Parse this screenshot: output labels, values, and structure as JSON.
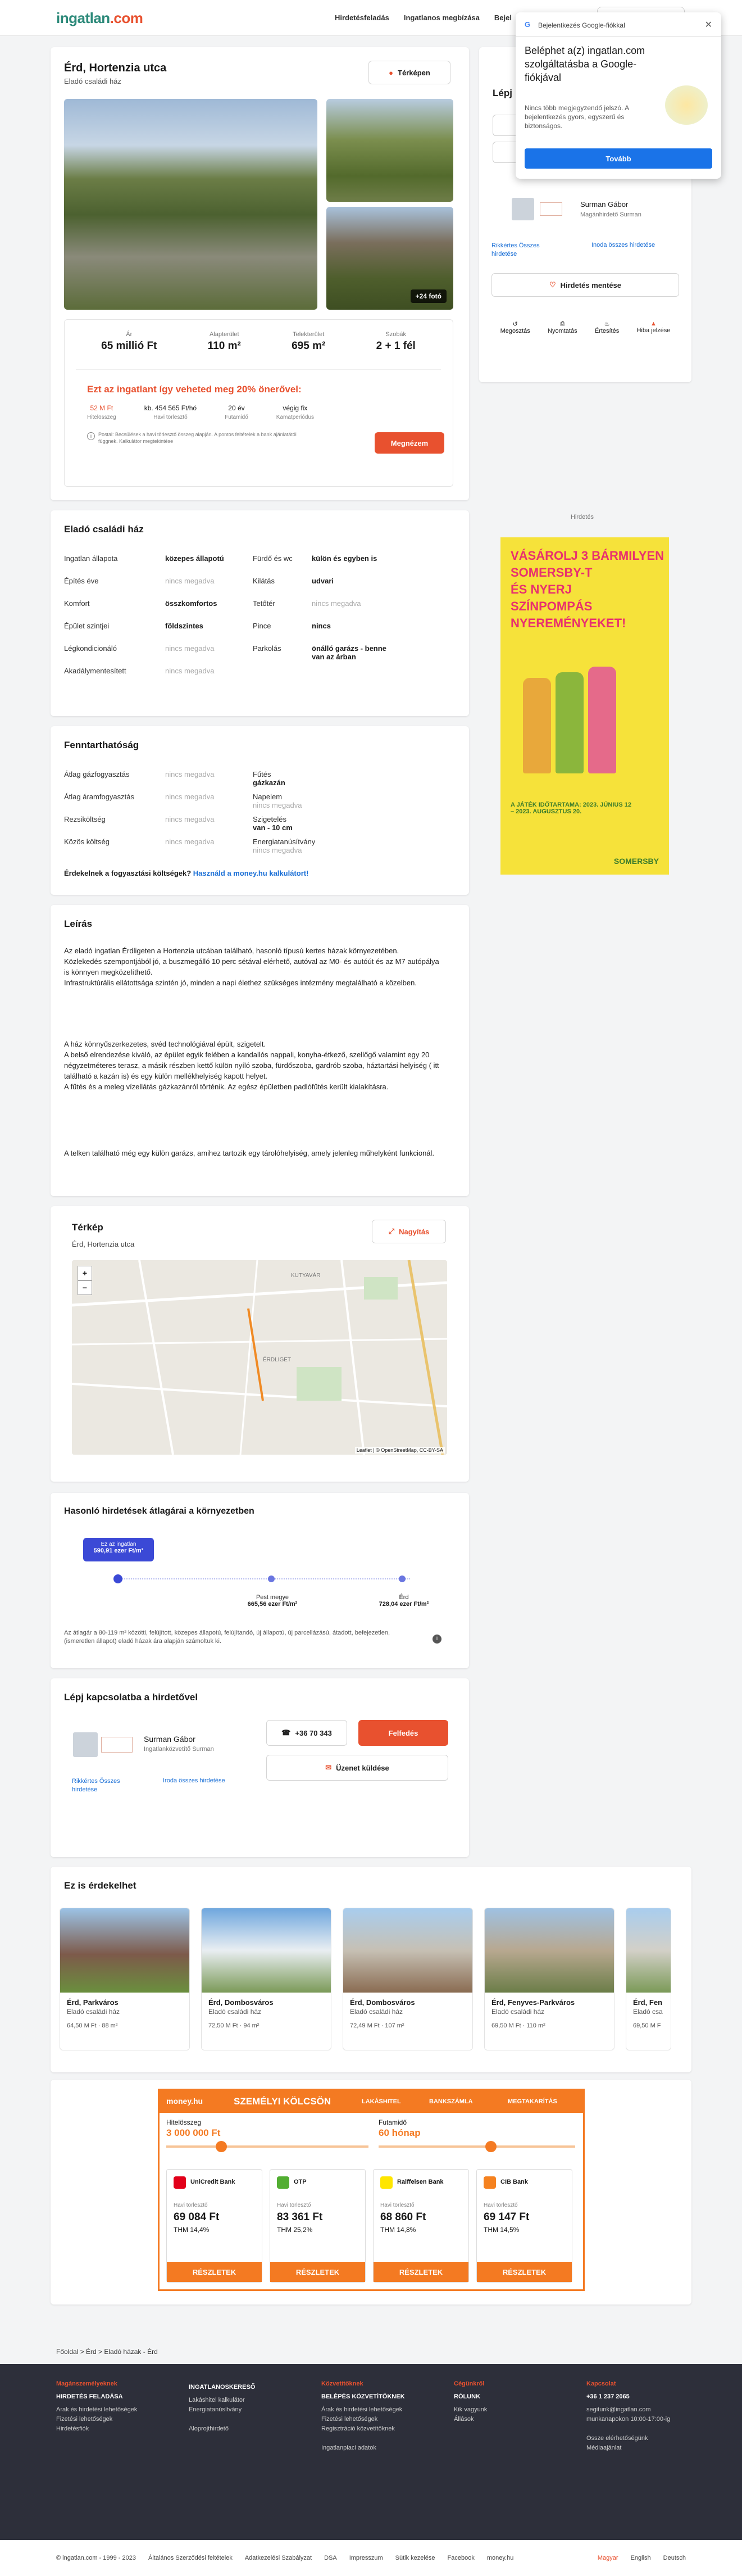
{
  "header": {
    "logo_main": "ingatlan",
    "logo_dot": ".com",
    "nav": [
      "Hirdetésfeladás",
      "Ingatlanos megbízása",
      "Bejel"
    ]
  },
  "popup": {
    "title": "Bejelentkezés Google-fiókkal",
    "heading": "Beléphet a(z) ingatlan.com szolgáltatásba a Google-fiókjával",
    "text": "Nincs több megjegyzendő jelszó. A bejelentkezés gyors, egyszerű és biztonságos.",
    "button": "Tovább"
  },
  "listing": {
    "title": "Érd, Hortenzia utca",
    "subtitle": "Eladó családi ház",
    "map_button": "Térképen",
    "photo_badge": "+24 fotó",
    "stats": [
      {
        "label": "Ár",
        "value": "65 millió Ft"
      },
      {
        "label": "Alapterület",
        "value": "110 m²"
      },
      {
        "label": "Telekterület",
        "value": "695 m²"
      },
      {
        "label": "Szobák",
        "value": "2 + 1 fél"
      }
    ],
    "loan_heading": "Ezt az ingatlant így veheted meg 20% önerővel:",
    "loan_values": [
      {
        "value": "52 M Ft",
        "label": "Hitelösszeg"
      },
      {
        "value": "kb. 454 565 Ft/hó",
        "label": "Havi törlesztő"
      },
      {
        "value": "20 év",
        "label": "Futamidő"
      },
      {
        "value": "végig fix",
        "label": "Kamatperiódus"
      }
    ],
    "loan_note": "Postai: Becsülések a havi törlesztő összeg alapján. A pontos feltételek a bank ajánlatától függnek. Kalkulátor megtekintése",
    "loan_button": "Megnézem"
  },
  "contact_side": {
    "title": "Lépj",
    "agent": "Surman Gábor",
    "agent_role": "Magánhirdető Surman",
    "link1": "Rikkértes Összes",
    "link1b": "hirdetése",
    "link2": "Inoda összes hirdetése",
    "save": "Hirdetés mentése",
    "actions": [
      "Megosztás",
      "Nyomtatás",
      "Értesítés",
      "Hiba jelzése"
    ]
  },
  "ad_label": "Hirdetés",
  "ad1": {
    "line1": "VÁSÁROLJ 3 BÁRMILYEN",
    "line2": "SOMERSBY-T",
    "line3": "ÉS NYERJ",
    "line4": "SZÍNPOMPÁS",
    "line5": "NYEREMÉNYEKET!",
    "brand": "SOMERSBY",
    "promo": "A JÁTÉK IDŐTARTAMA: 2023. JÚNIUS 12 – 2023. AUGUSZTUS 20."
  },
  "details": {
    "title": "Eladó családi ház",
    "left": [
      {
        "k": "Ingatlan állapota",
        "v": "közepes állapotú",
        "m": false
      },
      {
        "k": "Építés éve",
        "v": "nincs megadva",
        "m": true
      },
      {
        "k": "Komfort",
        "v": "összkomfortos",
        "m": false
      },
      {
        "k": "Épület szintjei",
        "v": "földszintes",
        "m": false
      },
      {
        "k": "Légkondicionáló",
        "v": "nincs megadva",
        "m": true
      },
      {
        "k": "Akadálymentesített",
        "v": "nincs megadva",
        "m": true
      }
    ],
    "right": [
      {
        "k": "Fürdő és wc",
        "v": "külön és egyben is",
        "m": false
      },
      {
        "k": "Kilátás",
        "v": "udvari",
        "m": false
      },
      {
        "k": "Tetőtér",
        "v": "nincs megadva",
        "m": true
      },
      {
        "k": "Pince",
        "v": "nincs",
        "m": false
      },
      {
        "k": "Parkolás",
        "v": "önálló garázs - benne van az árban",
        "m": false
      }
    ]
  },
  "sustain": {
    "title": "Fenntarthatóság",
    "left": [
      {
        "k": "Átlag gázfogyasztás",
        "v": "nincs megadva"
      },
      {
        "k": "Átlag áramfogyasztás",
        "v": "nincs megadva"
      },
      {
        "k": "Rezsiköltség",
        "v": "nincs megadva"
      },
      {
        "k": "Közös költség",
        "v": "nincs megadva"
      }
    ],
    "right": [
      {
        "k": "Fűtés",
        "v": "gázkazán",
        "m": false
      },
      {
        "k": "Napelem",
        "v": "nincs megadva",
        "m": true
      },
      {
        "k": "Szigetelés",
        "v": "van - 10 cm",
        "m": false
      },
      {
        "k": "Energiatanúsítvány",
        "v": "nincs megadva",
        "m": true
      }
    ],
    "question": "Érdekelnek a fogyasztási költségek?",
    "link": "Használd a money.hu kalkulátort!"
  },
  "desc": {
    "title": "Leírás",
    "p1": [
      "Az eladó ingatlan Érdligeten a Hortenzia utcában található, hasonló típusú kertes házak környezetében.",
      "Közlekedés szempontjából jó, a buszmegálló 10 perc sétával elérhető, autóval az M0- és autóút és az M7 autópálya is könnyen megközelíthető.",
      "Infrastruktúrális ellátottsága szintén jó, minden a napi élethez szükséges intézmény megtalálható a közelben."
    ],
    "p2": [
      "A ház könnyűszerkezetes, svéd technológiával épült, szigetelt.",
      "A belső elrendezése kiváló, az épület egyik felében a kandallós nappali, konyha-étkező, szellőgő valamint egy 20 négyzetméteres terasz, a másik részben kettő külön nyíló szoba, fürdőszoba, gardrób szoba, háztartási helyiség ( itt található a kazán is) és egy külön mellékhelyiség kapott helyet.",
      "A fűtés és a meleg vízellátás gázkazánról történik. Az egész épületben padlófűtés került kialakításra."
    ],
    "p3": [
      "A telken található még egy külön garázs, amihez tartozik egy tárolóhelyiség, amely jelenleg műhelyként funkcionál."
    ]
  },
  "map": {
    "title": "Térkép",
    "subtitle": "Érd, Hortenzia utca",
    "button": "Nagyítás",
    "zoom_in": "+",
    "zoom_out": "−",
    "labels": [
      "KUTYAVÁR",
      "ÉRDLIGET"
    ],
    "attrib": "Leaflet | © OpenStreetMap, CC-BY-SA"
  },
  "price_cmp": {
    "title": "Hasonló hirdetések átlagárai a környezetben",
    "bubble1": "Ez az ingatlan",
    "bubble2": "590,91 ezer Ft/m²",
    "p1": "Pest megye",
    "p1v": "665,56 ezer Ft/m²",
    "p2": "Érd",
    "p2v": "728,04 ezer Ft/m²",
    "note": "Az átlagár a 80-119 m² közötti, felújított, közepes állapotú, felújítandó, új állapotú, új parcellázású, átadott, befejezetlen, (ismeretlen állapot) eladó házak ára alapján számoltuk ki."
  },
  "contact": {
    "title": "Lépj kapcsolatba a hirdetővel",
    "agent": "Surman Gábor",
    "role": "Ingatlanközvetítő Surman",
    "phone": "+36 70 343",
    "reveal": "Felfedés",
    "message": "Üzenet küldése",
    "link1": "Rikkértes Összes",
    "link1b": "hirdetése",
    "link2": "Iroda összes hirdetése"
  },
  "similar": {
    "title": "Ez is érdekelhet",
    "items": [
      {
        "t": "Érd, Parkváros",
        "s": "Eladó családi ház",
        "p": "64,50 M Ft · 88 m²"
      },
      {
        "t": "Érd, Dombosváros",
        "s": "Eladó családi ház",
        "p": "72,50 M Ft · 94 m²"
      },
      {
        "t": "Érd, Dombosváros",
        "s": "Eladó családi ház",
        "p": "72,49 M Ft · 107 m²"
      },
      {
        "t": "Érd, Fenyves-Parkváros",
        "s": "Eladó családi ház",
        "p": "69,50 M Ft · 110 m²"
      },
      {
        "t": "Érd, Fen",
        "s": "Eladó csa",
        "p": "69,50 M F"
      }
    ]
  },
  "loan_ad": {
    "brand": "money.hu",
    "title": "SZEMÉLYI KÖLCSÖN",
    "tabs": [
      "LAKÁSHITEL",
      "BANKSZÁMLA",
      "MEGTAKARÍTÁS"
    ],
    "amount_label": "Hitelösszeg",
    "amount": "3 000 000 Ft",
    "term_label": "Futamidő",
    "term": "60 hónap",
    "banks": [
      {
        "n": "UniCredit Bank",
        "a": "69 084 Ft",
        "t": "THM 14,4%"
      },
      {
        "n": "OTP",
        "a": "83 361 Ft",
        "t": "THM 25,2%"
      },
      {
        "n": "Raiffeisen Bank",
        "a": "68 860 Ft",
        "t": "THM 14,8%"
      },
      {
        "n": "CIB Bank",
        "a": "69 147 Ft",
        "t": "THM 14,5%"
      }
    ],
    "monthly": "Havi törlesztő",
    "cta": "RÉSZLETEK"
  },
  "footer": {
    "breadcrumb": "Főoldal  >  Érd  >  Eladó házak - Érd",
    "cols": [
      {
        "h": "Magánszemélyeknek",
        "h2": "HIRDETÉS FELADÁSA",
        "items": [
          "Arak és hirdetési lehetőségek",
          "Fizetési lehetőségek",
          "Hirdetésfiók"
        ]
      },
      {
        "h": "",
        "h2": "INGATLANOSKERESŐ",
        "items": [
          "Lakáshitel kalkulátor",
          "Energiatanúsítvány",
          "",
          "Aloprojthirdető"
        ]
      },
      {
        "h": "Közvetítőknek",
        "h2": "BELÉPÉS KÖZVETÍTŐKNEK",
        "items": [
          "Árak és hirdetési lehetőségek",
          "Fizetési lehetőségek",
          "Regisztráció közvetítőknek",
          "",
          "Ingatlanpiaci adatok"
        ]
      },
      {
        "h": "Cégünkről",
        "h2": "RÓLUNK",
        "items": [
          "Kik vagyunk",
          "Állások"
        ]
      },
      {
        "h": "Kapcsolat",
        "h2": "+36 1 237 2065",
        "items": [
          "segitunk@ingatlan.com",
          "munkanapokon 10:00-17:00-ig",
          "",
          "Ossze elérhetőségünk",
          "Médiaajánlat"
        ]
      }
    ],
    "bottom": [
      "© ingatlan.com - 1999 - 2023",
      "Általános Szerződési feltételek",
      "Adatkezelési Szabályzat",
      "DSA",
      "Impresszum",
      "Sütik kezelése",
      "Facebook",
      "money.hu"
    ],
    "langs": [
      "Magyar",
      "English",
      "Deutsch"
    ]
  }
}
